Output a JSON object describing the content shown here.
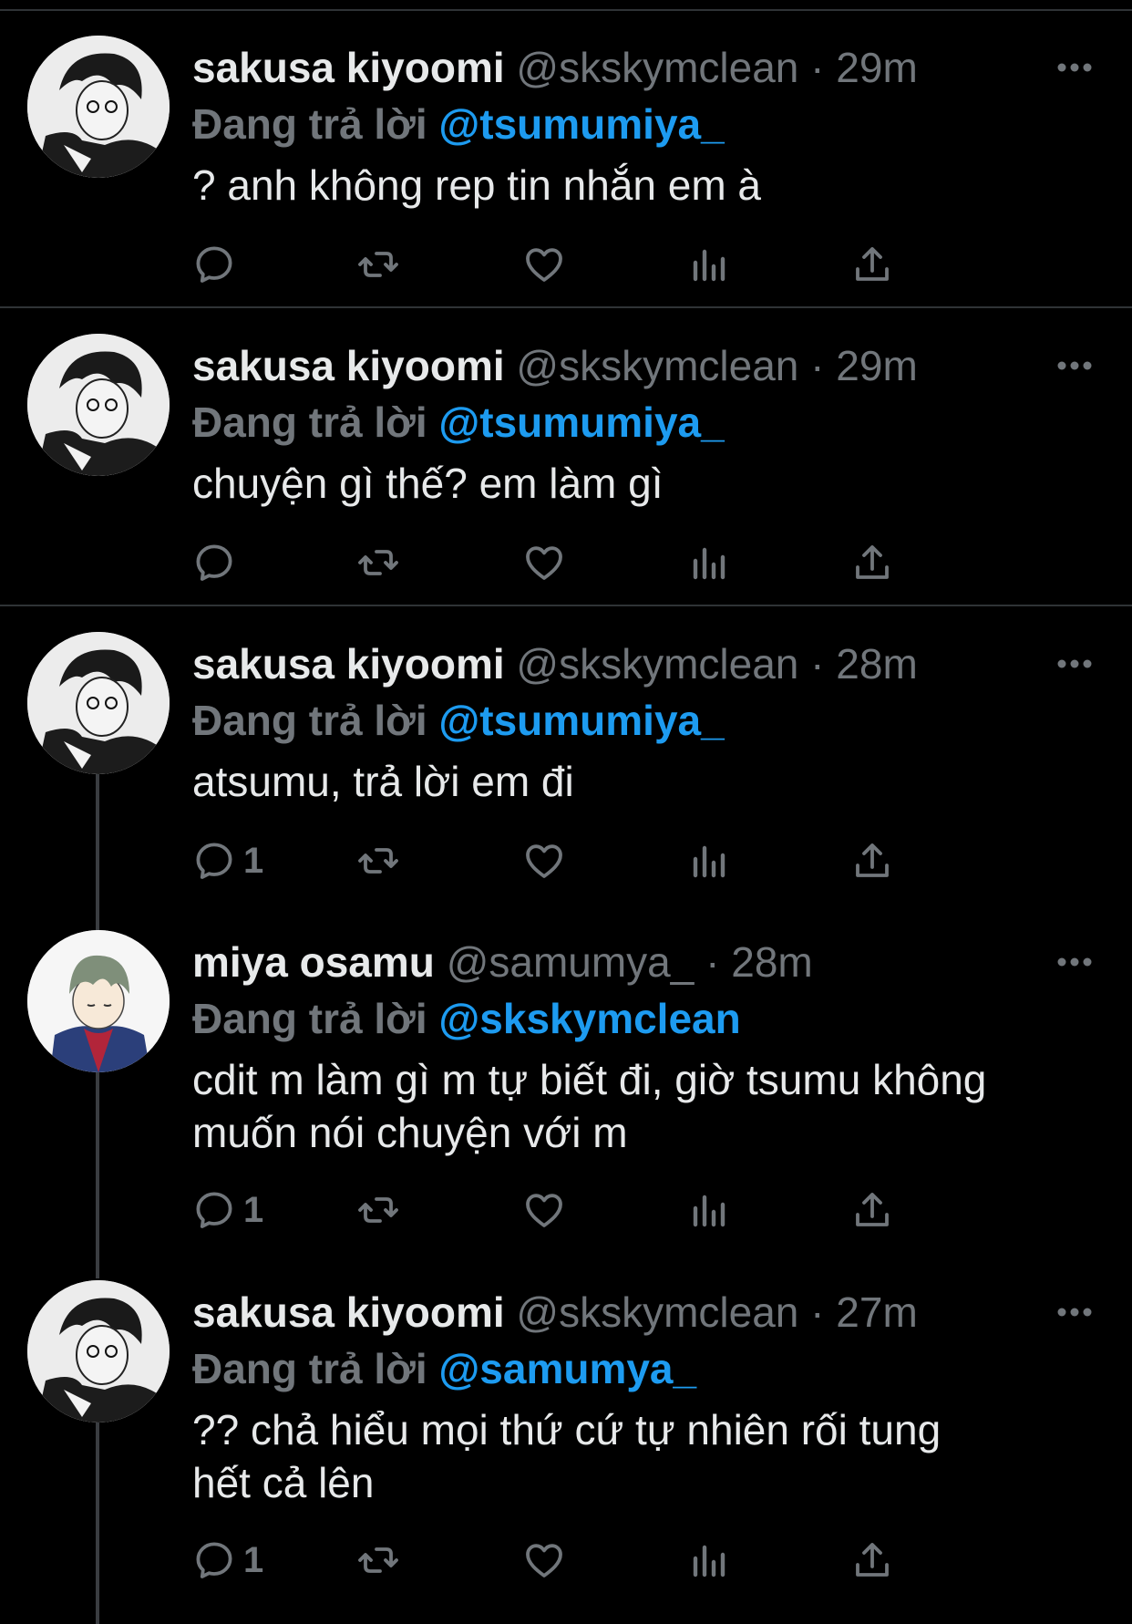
{
  "colors": {
    "background": "#000000",
    "primary_text": "#e7e9ea",
    "secondary_text": "#71767b",
    "link": "#1d9bf0",
    "divider": "#2f3336"
  },
  "icons": {
    "reply": "reply-icon",
    "retweet": "retweet-icon",
    "like": "heart-icon",
    "views": "bar-chart-icon",
    "share": "share-icon",
    "more": "more-options-icon"
  },
  "tweets": [
    {
      "name": "sakusa kiyoomi",
      "handle": "@skskymclean",
      "separator": "·",
      "time": "29m",
      "reply_prefix": "Đang trả lời",
      "reply_to": "@tsumumiya_",
      "text_lines": [
        "? anh không rep tin nhắn em à"
      ],
      "reply_count": ""
    },
    {
      "name": "sakusa kiyoomi",
      "handle": "@skskymclean",
      "separator": "·",
      "time": "29m",
      "reply_prefix": "Đang trả lời",
      "reply_to": "@tsumumiya_",
      "text_lines": [
        "chuyện gì thế? em làm gì"
      ],
      "reply_count": ""
    },
    {
      "name": "sakusa kiyoomi",
      "handle": "@skskymclean",
      "separator": "·",
      "time": "28m",
      "reply_prefix": "Đang trả lời",
      "reply_to": "@tsumumiya_",
      "text_lines": [
        "atsumu, trả lời em đi"
      ],
      "reply_count": "1"
    },
    {
      "name": "miya osamu",
      "handle": "@samumya_",
      "separator": "·",
      "time": "28m",
      "reply_prefix": "Đang trả lời",
      "reply_to": "@skskymclean",
      "text_lines": [
        "cdit m làm gì m tự biết đi, giờ tsumu không",
        "muốn nói chuyện với m"
      ],
      "reply_count": "1"
    },
    {
      "name": "sakusa kiyoomi",
      "handle": "@skskymclean",
      "separator": "·",
      "time": "27m",
      "reply_prefix": "Đang trả lời",
      "reply_to": "@samumya_",
      "text_lines": [
        "?? chả hiểu mọi thứ cứ tự nhiên rối tung",
        "hết cả lên"
      ],
      "reply_count": "1"
    }
  ]
}
